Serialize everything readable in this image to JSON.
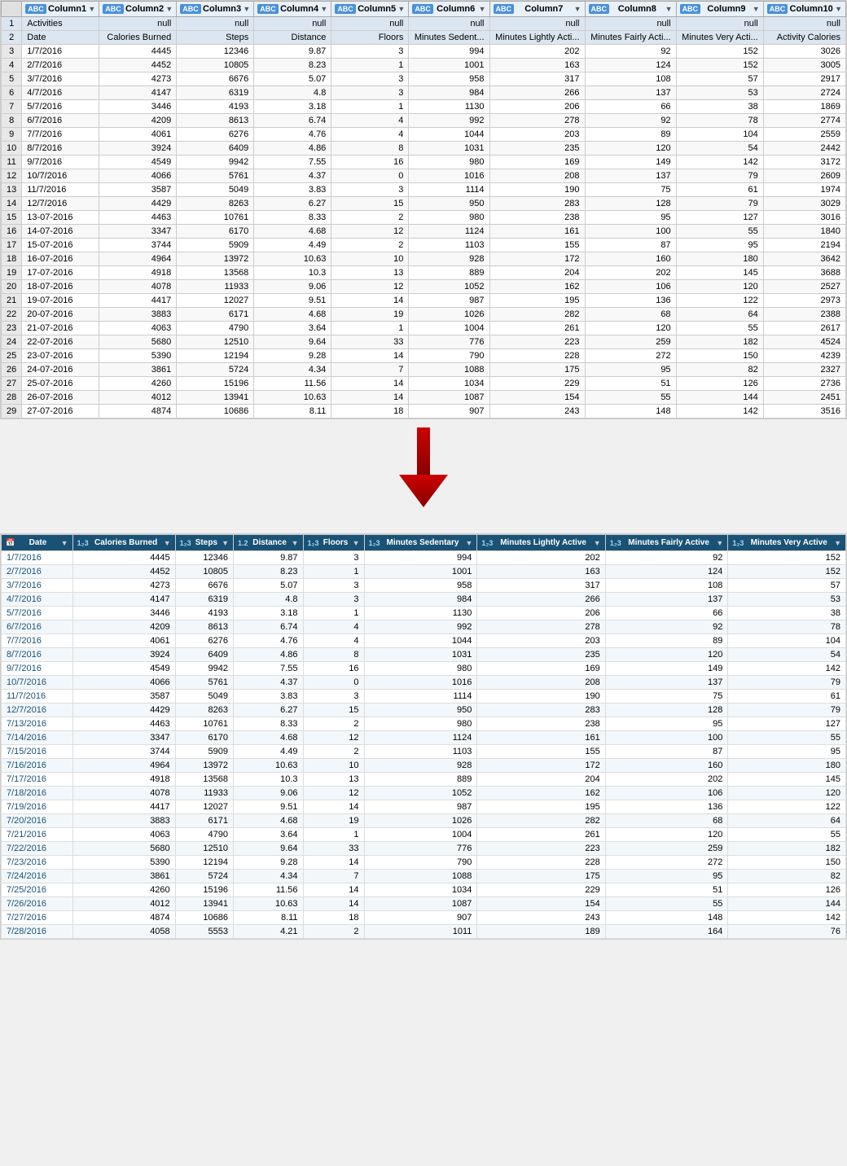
{
  "top_table": {
    "headers": [
      {
        "type": "ABC",
        "name": "Column1",
        "subtype": "ABC"
      },
      {
        "type": "ABC",
        "name": "Column2",
        "subtype": "ABC"
      },
      {
        "type": "ABC",
        "name": "Column3",
        "subtype": "ABC"
      },
      {
        "type": "ABC",
        "name": "Column4",
        "subtype": "ABC"
      },
      {
        "type": "ABC",
        "name": "Column5",
        "subtype": "ABC"
      },
      {
        "type": "ABC",
        "name": "Column6",
        "subtype": "ABC"
      },
      {
        "type": "ABC",
        "name": "Column7",
        "subtype": "ABC"
      },
      {
        "type": "ABC",
        "name": "Column8",
        "subtype": "ABC"
      },
      {
        "type": "ABC",
        "name": "Column9",
        "subtype": "ABC"
      },
      {
        "type": "ABC",
        "name": "Column10",
        "subtype": "ABC"
      }
    ],
    "rows": [
      {
        "num": 1,
        "cells": [
          "Activities",
          "null",
          "null",
          "null",
          "null",
          "null",
          "null",
          "null",
          "null",
          "null"
        ]
      },
      {
        "num": 2,
        "cells": [
          "Date",
          "Calories Burned",
          "Steps",
          "Distance",
          "Floors",
          "Minutes Sedent...",
          "Minutes Lightly Acti...",
          "Minutes Fairly Acti...",
          "Minutes Very Acti...",
          "Activity Calories"
        ]
      },
      {
        "num": 3,
        "cells": [
          "1/7/2016",
          "4445",
          "12346",
          "9.87",
          "3",
          "994",
          "202",
          "92",
          "152",
          "3026"
        ]
      },
      {
        "num": 4,
        "cells": [
          "2/7/2016",
          "4452",
          "10805",
          "8.23",
          "1",
          "1001",
          "163",
          "124",
          "152",
          "3005"
        ]
      },
      {
        "num": 5,
        "cells": [
          "3/7/2016",
          "4273",
          "6676",
          "5.07",
          "3",
          "958",
          "317",
          "108",
          "57",
          "2917"
        ]
      },
      {
        "num": 6,
        "cells": [
          "4/7/2016",
          "4147",
          "6319",
          "4.8",
          "3",
          "984",
          "266",
          "137",
          "53",
          "2724"
        ]
      },
      {
        "num": 7,
        "cells": [
          "5/7/2016",
          "3446",
          "4193",
          "3.18",
          "1",
          "1130",
          "206",
          "66",
          "38",
          "1869"
        ]
      },
      {
        "num": 8,
        "cells": [
          "6/7/2016",
          "4209",
          "8613",
          "6.74",
          "4",
          "992",
          "278",
          "92",
          "78",
          "2774"
        ]
      },
      {
        "num": 9,
        "cells": [
          "7/7/2016",
          "4061",
          "6276",
          "4.76",
          "4",
          "1044",
          "203",
          "89",
          "104",
          "2559"
        ]
      },
      {
        "num": 10,
        "cells": [
          "8/7/2016",
          "3924",
          "6409",
          "4.86",
          "8",
          "1031",
          "235",
          "120",
          "54",
          "2442"
        ]
      },
      {
        "num": 11,
        "cells": [
          "9/7/2016",
          "4549",
          "9942",
          "7.55",
          "16",
          "980",
          "169",
          "149",
          "142",
          "3172"
        ]
      },
      {
        "num": 12,
        "cells": [
          "10/7/2016",
          "4066",
          "5761",
          "4.37",
          "0",
          "1016",
          "208",
          "137",
          "79",
          "2609"
        ]
      },
      {
        "num": 13,
        "cells": [
          "11/7/2016",
          "3587",
          "5049",
          "3.83",
          "3",
          "1114",
          "190",
          "75",
          "61",
          "1974"
        ]
      },
      {
        "num": 14,
        "cells": [
          "12/7/2016",
          "4429",
          "8263",
          "6.27",
          "15",
          "950",
          "283",
          "128",
          "79",
          "3029"
        ]
      },
      {
        "num": 15,
        "cells": [
          "13-07-2016",
          "4463",
          "10761",
          "8.33",
          "2",
          "980",
          "238",
          "95",
          "127",
          "3016"
        ]
      },
      {
        "num": 16,
        "cells": [
          "14-07-2016",
          "3347",
          "6170",
          "4.68",
          "12",
          "1124",
          "161",
          "100",
          "55",
          "1840"
        ]
      },
      {
        "num": 17,
        "cells": [
          "15-07-2016",
          "3744",
          "5909",
          "4.49",
          "2",
          "1103",
          "155",
          "87",
          "95",
          "2194"
        ]
      },
      {
        "num": 18,
        "cells": [
          "16-07-2016",
          "4964",
          "13972",
          "10.63",
          "10",
          "928",
          "172",
          "160",
          "180",
          "3642"
        ]
      },
      {
        "num": 19,
        "cells": [
          "17-07-2016",
          "4918",
          "13568",
          "10.3",
          "13",
          "889",
          "204",
          "202",
          "145",
          "3688"
        ]
      },
      {
        "num": 20,
        "cells": [
          "18-07-2016",
          "4078",
          "11933",
          "9.06",
          "12",
          "1052",
          "162",
          "106",
          "120",
          "2527"
        ]
      },
      {
        "num": 21,
        "cells": [
          "19-07-2016",
          "4417",
          "12027",
          "9.51",
          "14",
          "987",
          "195",
          "136",
          "122",
          "2973"
        ]
      },
      {
        "num": 22,
        "cells": [
          "20-07-2016",
          "3883",
          "6171",
          "4.68",
          "19",
          "1026",
          "282",
          "68",
          "64",
          "2388"
        ]
      },
      {
        "num": 23,
        "cells": [
          "21-07-2016",
          "4063",
          "4790",
          "3.64",
          "1",
          "1004",
          "261",
          "120",
          "55",
          "2617"
        ]
      },
      {
        "num": 24,
        "cells": [
          "22-07-2016",
          "5680",
          "12510",
          "9.64",
          "33",
          "776",
          "223",
          "259",
          "182",
          "4524"
        ]
      },
      {
        "num": 25,
        "cells": [
          "23-07-2016",
          "5390",
          "12194",
          "9.28",
          "14",
          "790",
          "228",
          "272",
          "150",
          "4239"
        ]
      },
      {
        "num": 26,
        "cells": [
          "24-07-2016",
          "3861",
          "5724",
          "4.34",
          "7",
          "1088",
          "175",
          "95",
          "82",
          "2327"
        ]
      },
      {
        "num": 27,
        "cells": [
          "25-07-2016",
          "4260",
          "15196",
          "11.56",
          "14",
          "1034",
          "229",
          "51",
          "126",
          "2736"
        ]
      },
      {
        "num": 28,
        "cells": [
          "26-07-2016",
          "4012",
          "13941",
          "10.63",
          "14",
          "1087",
          "154",
          "55",
          "144",
          "2451"
        ]
      },
      {
        "num": 29,
        "cells": [
          "27-07-2016",
          "4874",
          "10686",
          "8.11",
          "18",
          "907",
          "243",
          "148",
          "142",
          "3516"
        ]
      }
    ]
  },
  "bottom_table": {
    "headers": [
      {
        "icon": "calendar",
        "type": "Date",
        "name": "Date"
      },
      {
        "icon": "123",
        "type": "1₂3",
        "name": "Calories Burned"
      },
      {
        "icon": "123",
        "type": "1₂3",
        "name": "Steps"
      },
      {
        "icon": "123",
        "type": "1.2",
        "name": "Distance"
      },
      {
        "icon": "123",
        "type": "1₂3",
        "name": "Floors"
      },
      {
        "icon": "123",
        "type": "1₂3",
        "name": "Minutes Sedentary"
      },
      {
        "icon": "123",
        "type": "1₂3",
        "name": "Minutes Lightly Active"
      },
      {
        "icon": "123",
        "type": "1₂3",
        "name": "Minutes Fairly Active"
      },
      {
        "icon": "123",
        "type": "1₂3",
        "name": "Minutes Very Active"
      }
    ],
    "rows": [
      {
        "cells": [
          "1/7/2016",
          "4445",
          "12346",
          "9.87",
          "3",
          "994",
          "202",
          "92",
          "152"
        ]
      },
      {
        "cells": [
          "2/7/2016",
          "4452",
          "10805",
          "8.23",
          "1",
          "1001",
          "163",
          "124",
          "152"
        ]
      },
      {
        "cells": [
          "3/7/2016",
          "4273",
          "6676",
          "5.07",
          "3",
          "958",
          "317",
          "108",
          "57"
        ]
      },
      {
        "cells": [
          "4/7/2016",
          "4147",
          "6319",
          "4.8",
          "3",
          "984",
          "266",
          "137",
          "53"
        ]
      },
      {
        "cells": [
          "5/7/2016",
          "3446",
          "4193",
          "3.18",
          "1",
          "1130",
          "206",
          "66",
          "38"
        ]
      },
      {
        "cells": [
          "6/7/2016",
          "4209",
          "8613",
          "6.74",
          "4",
          "992",
          "278",
          "92",
          "78"
        ]
      },
      {
        "cells": [
          "7/7/2016",
          "4061",
          "6276",
          "4.76",
          "4",
          "1044",
          "203",
          "89",
          "104"
        ]
      },
      {
        "cells": [
          "8/7/2016",
          "3924",
          "6409",
          "4.86",
          "8",
          "1031",
          "235",
          "120",
          "54"
        ]
      },
      {
        "cells": [
          "9/7/2016",
          "4549",
          "9942",
          "7.55",
          "16",
          "980",
          "169",
          "149",
          "142"
        ]
      },
      {
        "cells": [
          "10/7/2016",
          "4066",
          "5761",
          "4.37",
          "0",
          "1016",
          "208",
          "137",
          "79"
        ]
      },
      {
        "cells": [
          "11/7/2016",
          "3587",
          "5049",
          "3.83",
          "3",
          "1114",
          "190",
          "75",
          "61"
        ]
      },
      {
        "cells": [
          "12/7/2016",
          "4429",
          "8263",
          "6.27",
          "15",
          "950",
          "283",
          "128",
          "79"
        ]
      },
      {
        "cells": [
          "7/13/2016",
          "4463",
          "10761",
          "8.33",
          "2",
          "980",
          "238",
          "95",
          "127"
        ]
      },
      {
        "cells": [
          "7/14/2016",
          "3347",
          "6170",
          "4.68",
          "12",
          "1124",
          "161",
          "100",
          "55"
        ]
      },
      {
        "cells": [
          "7/15/2016",
          "3744",
          "5909",
          "4.49",
          "2",
          "1103",
          "155",
          "87",
          "95"
        ]
      },
      {
        "cells": [
          "7/16/2016",
          "4964",
          "13972",
          "10.63",
          "10",
          "928",
          "172",
          "160",
          "180"
        ]
      },
      {
        "cells": [
          "7/17/2016",
          "4918",
          "13568",
          "10.3",
          "13",
          "889",
          "204",
          "202",
          "145"
        ]
      },
      {
        "cells": [
          "7/18/2016",
          "4078",
          "11933",
          "9.06",
          "12",
          "1052",
          "162",
          "106",
          "120"
        ]
      },
      {
        "cells": [
          "7/19/2016",
          "4417",
          "12027",
          "9.51",
          "14",
          "987",
          "195",
          "136",
          "122"
        ]
      },
      {
        "cells": [
          "7/20/2016",
          "3883",
          "6171",
          "4.68",
          "19",
          "1026",
          "282",
          "68",
          "64"
        ]
      },
      {
        "cells": [
          "7/21/2016",
          "4063",
          "4790",
          "3.64",
          "1",
          "1004",
          "261",
          "120",
          "55"
        ]
      },
      {
        "cells": [
          "7/22/2016",
          "5680",
          "12510",
          "9.64",
          "33",
          "776",
          "223",
          "259",
          "182"
        ]
      },
      {
        "cells": [
          "7/23/2016",
          "5390",
          "12194",
          "9.28",
          "14",
          "790",
          "228",
          "272",
          "150"
        ]
      },
      {
        "cells": [
          "7/24/2016",
          "3861",
          "5724",
          "4.34",
          "7",
          "1088",
          "175",
          "95",
          "82"
        ]
      },
      {
        "cells": [
          "7/25/2016",
          "4260",
          "15196",
          "11.56",
          "14",
          "1034",
          "229",
          "51",
          "126"
        ]
      },
      {
        "cells": [
          "7/26/2016",
          "4012",
          "13941",
          "10.63",
          "14",
          "1087",
          "154",
          "55",
          "144"
        ]
      },
      {
        "cells": [
          "7/27/2016",
          "4874",
          "10686",
          "8.11",
          "18",
          "907",
          "243",
          "148",
          "142"
        ]
      },
      {
        "cells": [
          "7/28/2016",
          "4058",
          "5553",
          "4.21",
          "2",
          "1011",
          "189",
          "164",
          "76"
        ]
      }
    ]
  }
}
